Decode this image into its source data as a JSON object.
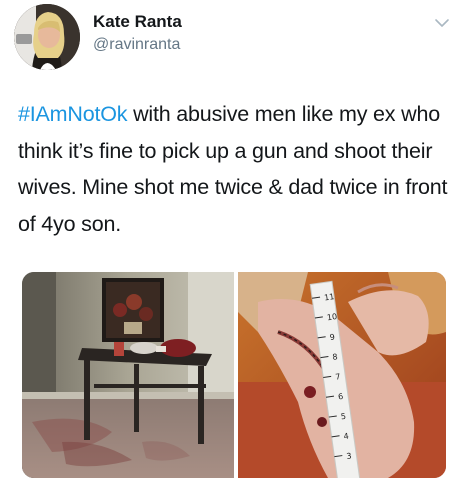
{
  "author": {
    "name": "Kate Ranta",
    "handle": "@ravinranta"
  },
  "tweet": {
    "hashtag": "#IAmNotOk",
    "text": " with abusive men like my ex who think it’s fine to pick up a gun and shoot their wives. Mine shot me twice & dad twice in front of 4yo son."
  },
  "icons": {
    "avatar": "profile-photo",
    "menu": "chevron-down-icon"
  },
  "media": {
    "images": [
      "room-with-table-photo",
      "wounded-hand-with-ruler-photo"
    ]
  },
  "colors": {
    "name": "#14171a",
    "handle": "#657786",
    "hashtag": "#1b95e0",
    "text": "#14171a"
  }
}
